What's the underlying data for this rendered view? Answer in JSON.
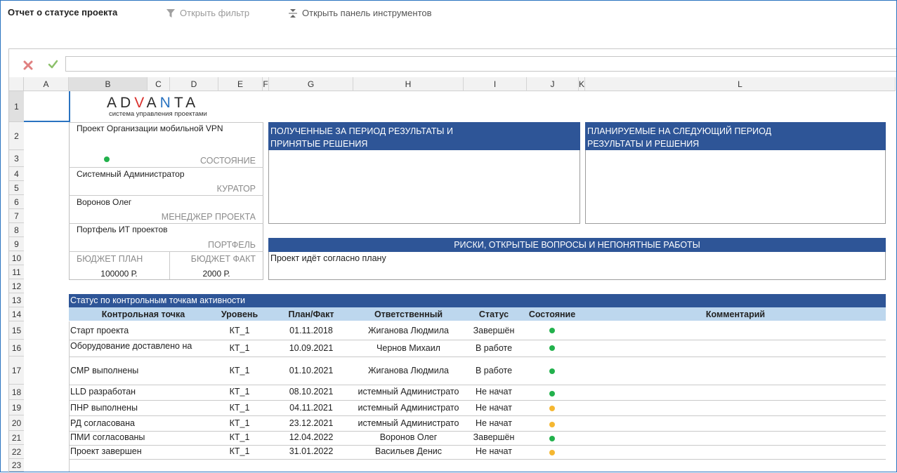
{
  "toolbar": {
    "title": "Отчет о статусе проекта",
    "open_filter": "Открыть фильтр",
    "open_tools": "Открыть панель инструментов"
  },
  "columns": [
    "A",
    "B",
    "C",
    "D",
    "E",
    "F",
    "G",
    "H",
    "I",
    "J",
    "K",
    "L"
  ],
  "rows": [
    "1",
    "2",
    "3",
    "4",
    "5",
    "6",
    "7",
    "8",
    "9",
    "10",
    "11",
    "12",
    "13",
    "14",
    "15",
    "16",
    "17",
    "18",
    "19",
    "20",
    "21",
    "22",
    "23"
  ],
  "logo": {
    "brand": "ADVANTA",
    "tagline": "система управления проектами"
  },
  "project": {
    "name": "Проект Организации мобильной VPN",
    "state_label": "СОСТОЯНИЕ",
    "state_color": "#22b14c",
    "curator": "Системный Администратор",
    "curator_label": "КУРАТОР",
    "manager": "Воронов Олег",
    "manager_label": "МЕНЕДЖЕР ПРОЕКТА",
    "portfolio": "Портфель ИТ проектов",
    "portfolio_label": "ПОРТФЕЛЬ",
    "budget_plan_label": "БЮДЖЕТ ПЛАН",
    "budget_fact_label": "БЮДЖЕТ ФАКТ",
    "budget_plan": "100000 Р.",
    "budget_fact": "2000 Р."
  },
  "panels": {
    "results_line1": "ПОЛУЧЕННЫЕ ЗА ПЕРИОД РЕЗУЛЬТАТЫ И",
    "results_line2": "ПРИНЯТЫЕ РЕШЕНИЯ",
    "planned_line1": "ПЛАНИРУЕМЫЕ НА СЛЕДУЮЩИЙ ПЕРИОД",
    "planned_line2": "РЕЗУЛЬТАТЫ И РЕШЕНИЯ",
    "risks_title": "РИСКИ, ОТКРЫТЫЕ ВОПРОСЫ И НЕПОНЯТНЫЕ РАБОТЫ",
    "risks_text": "Проект идёт согласно плану"
  },
  "milestones": {
    "title": "Статус по контрольным точкам активности",
    "headers": {
      "point": "Контрольная точка",
      "level": "Уровень",
      "plan": "План/Факт",
      "owner": "Ответственный",
      "status": "Статус",
      "state": "Состояние",
      "comment": "Комментарий"
    },
    "items": [
      {
        "point": "Старт проекта",
        "level": "КТ_1",
        "plan": "01.11.2018",
        "owner": "Жиганова Людмила",
        "status": "Завершён",
        "color": "#22b14c"
      },
      {
        "point": "Оборудование доставлено на",
        "level": "КТ_1",
        "plan": "10.09.2021",
        "owner": "Чернов Михаил",
        "status": "В работе",
        "color": "#22b14c"
      },
      {
        "point": "СМР выполнены",
        "level": "КТ_1",
        "plan": "01.10.2021",
        "owner": "Жиганова Людмила",
        "status": "В работе",
        "color": "#22b14c"
      },
      {
        "point": "LLD разработан",
        "level": "КТ_1",
        "plan": "08.10.2021",
        "owner": "истемный Администрато",
        "status": "Не начат",
        "color": "#22b14c"
      },
      {
        "point": "ПНР выполнены",
        "level": "КТ_1",
        "plan": "04.11.2021",
        "owner": "истемный Администрато",
        "status": "Не начат",
        "color": "#f5b731"
      },
      {
        "point": "РД согласована",
        "level": "КТ_1",
        "plan": "23.12.2021",
        "owner": "истемный Администрато",
        "status": "Не начат",
        "color": "#f5b731"
      },
      {
        "point": "ПМИ согласованы",
        "level": "КТ_1",
        "plan": "12.04.2022",
        "owner": "Воронов Олег",
        "status": "Завершён",
        "color": "#22b14c"
      },
      {
        "point": "Проект завершен",
        "level": "КТ_1",
        "plan": "31.01.2022",
        "owner": "Васильев Денис",
        "status": "Не начат",
        "color": "#f5b731"
      }
    ]
  }
}
